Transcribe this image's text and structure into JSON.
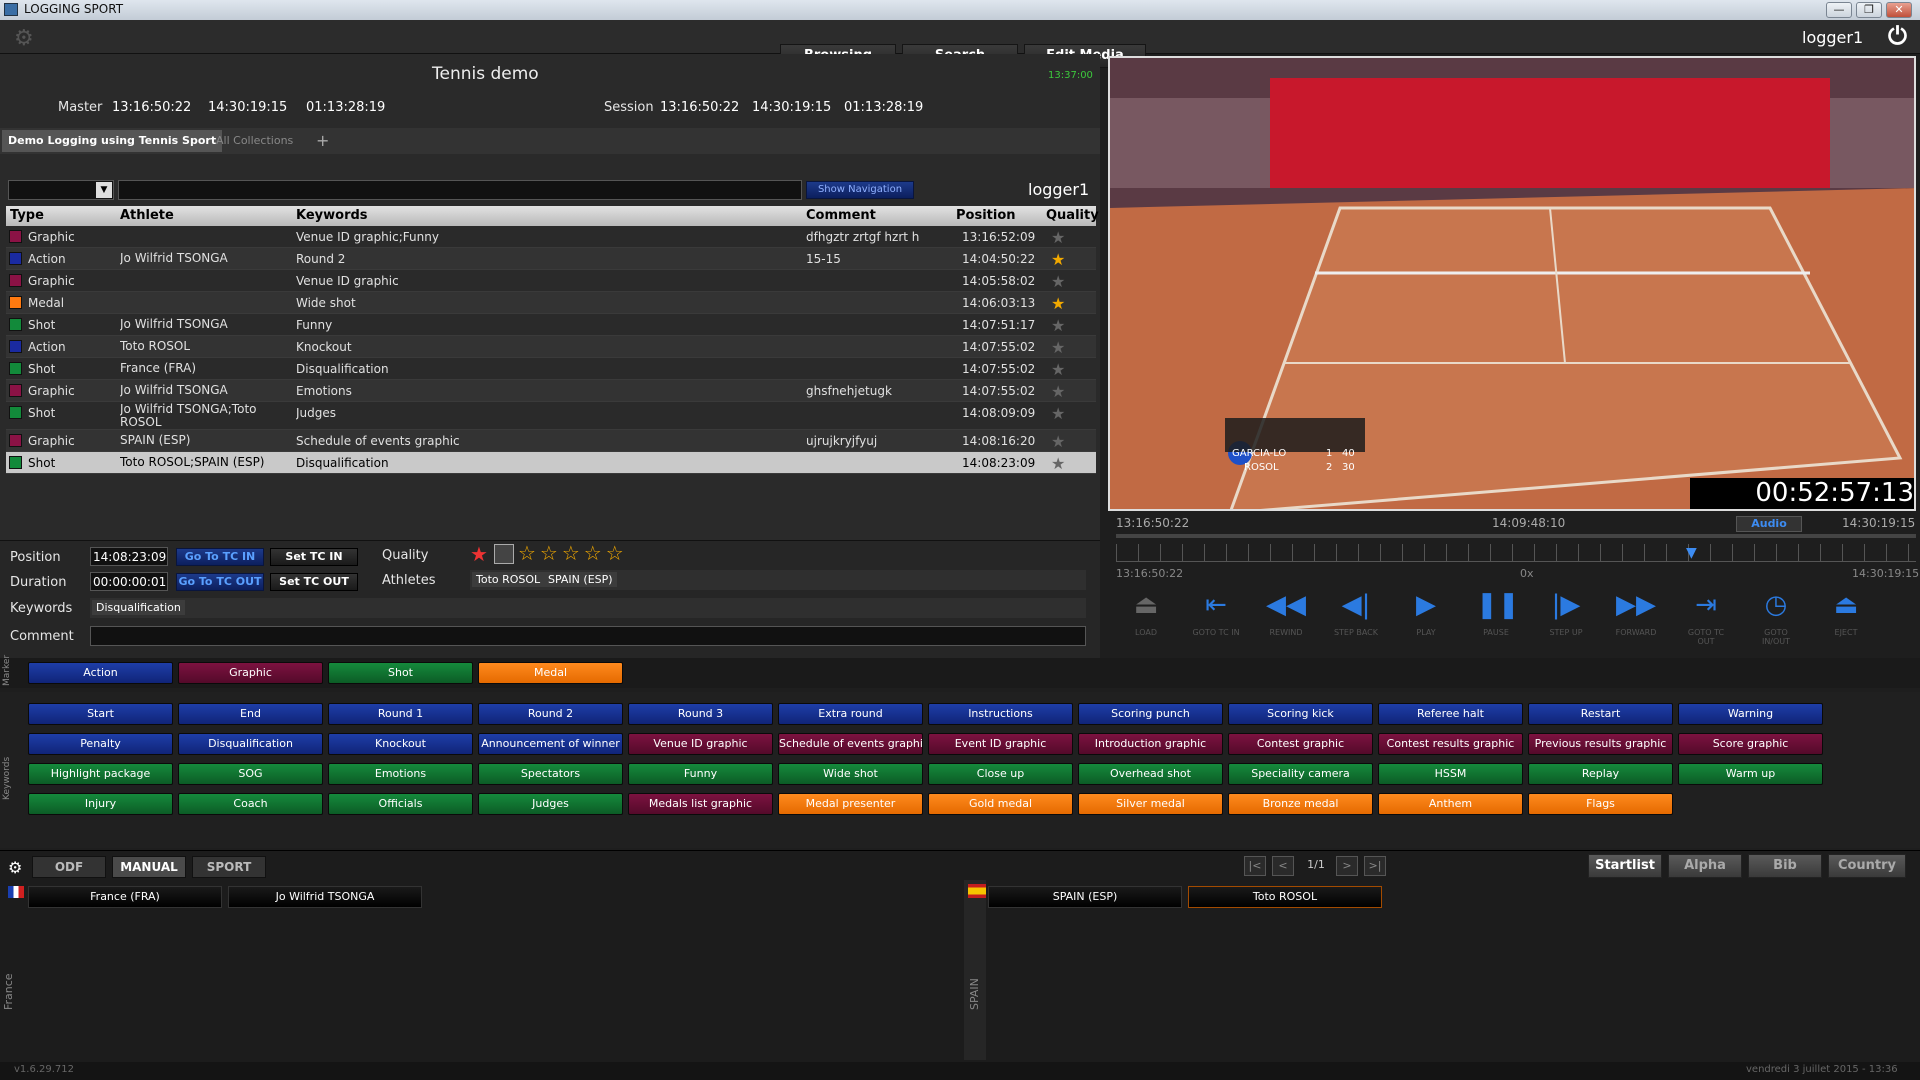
{
  "window": {
    "title": "LOGGING SPORT",
    "min": "—",
    "max": "❐",
    "close": "✕"
  },
  "nav": {
    "browsing": "Browsing",
    "search": "Search",
    "edit_media": "Edit Media",
    "user": "logger1"
  },
  "session": {
    "title": "Tennis demo",
    "clock": "13:37:00",
    "master_label": "Master",
    "master_in": "13:16:50:22",
    "master_out": "14:30:19:15",
    "master_dur": "01:13:28:19",
    "session_label": "Session",
    "session_in": "13:16:50:22",
    "session_out": "14:30:19:15",
    "session_dur": "01:13:28:19"
  },
  "tabs": {
    "active": "Demo Logging using Tennis Sport",
    "all": "All Collections",
    "add": "+"
  },
  "filter": {
    "show_nav": "Show Navigation",
    "user": "logger1"
  },
  "columns": {
    "type": "Type",
    "athlete": "Athlete",
    "keywords": "Keywords",
    "comment": "Comment",
    "position": "Position",
    "quality": "Quality"
  },
  "rows": [
    {
      "color": "#8b1245",
      "type": "Graphic",
      "athlete": "",
      "keywords": "Venue ID graphic;Funny",
      "comment": "dfhgztr zrtgf hzrt h",
      "position": "13:16:52:09",
      "starred": false
    },
    {
      "color": "#1a2aa0",
      "type": "Action",
      "athlete": "Jo Wilfrid TSONGA",
      "keywords": "Round 2",
      "comment": "15-15",
      "position": "14:04:50:22",
      "starred": true
    },
    {
      "color": "#8b1245",
      "type": "Graphic",
      "athlete": "",
      "keywords": "Venue ID graphic",
      "comment": "",
      "position": "14:05:58:02",
      "starred": false
    },
    {
      "color": "#ff7a10",
      "type": "Medal",
      "athlete": "",
      "keywords": "Wide shot",
      "comment": "",
      "position": "14:06:03:13",
      "starred": true
    },
    {
      "color": "#128a3a",
      "type": "Shot",
      "athlete": "Jo Wilfrid TSONGA",
      "keywords": "Funny",
      "comment": "",
      "position": "14:07:51:17",
      "starred": false
    },
    {
      "color": "#1a2aa0",
      "type": "Action",
      "athlete": "Toto ROSOL",
      "keywords": "Knockout",
      "comment": "",
      "position": "14:07:55:02",
      "starred": false
    },
    {
      "color": "#128a3a",
      "type": "Shot",
      "athlete": "France (FRA)",
      "keywords": "Disqualification",
      "comment": "",
      "position": "14:07:55:02",
      "starred": false
    },
    {
      "color": "#8b1245",
      "type": "Graphic",
      "athlete": "Jo Wilfrid TSONGA",
      "keywords": "Emotions",
      "comment": "ghsfnehjetugk",
      "position": "14:07:55:02",
      "starred": false
    },
    {
      "color": "#128a3a",
      "type": "Shot",
      "athlete": "Jo Wilfrid TSONGA;Toto ROSOL",
      "keywords": "Judges",
      "comment": "",
      "position": "14:08:09:09",
      "starred": false
    },
    {
      "color": "#8b1245",
      "type": "Graphic",
      "athlete": "SPAIN (ESP)",
      "keywords": "Schedule of events graphic",
      "comment": "ujrujkryjfyuj",
      "position": "14:08:16:20",
      "starred": false
    },
    {
      "color": "#128a3a",
      "type": "Shot",
      "athlete": "Toto ROSOL;SPAIN (ESP)",
      "keywords": "Disqualification",
      "comment": "",
      "position": "14:08:23:09",
      "starred": false
    }
  ],
  "detail": {
    "position_label": "Position",
    "position": "14:08:23:09",
    "duration_label": "Duration",
    "duration": "00:00:00:01",
    "goto_in": "Go To TC IN",
    "set_in": "Set TC IN",
    "goto_out": "Go To TC OUT",
    "set_out": "Set TC OUT",
    "quality_label": "Quality",
    "athletes_label": "Athletes",
    "athlete1": "Toto ROSOL",
    "athlete2": "SPAIN (ESP)",
    "keywords_label": "Keywords",
    "keyword": "Disqualification",
    "comment_label": "Comment"
  },
  "video": {
    "timecode": "00:52:57:13",
    "tc_start": "13:16:50:22",
    "tc_mid": "14:09:48:10",
    "audio": "Audio",
    "tc_end": "14:30:19:15",
    "tl_start": "13:16:50:22",
    "speed": "0x",
    "tl_end": "14:30:19:15",
    "score_p1": "GARCIA-LO",
    "score_p1_pts": "40",
    "score_p1_set": "1",
    "score_p2": "ROSOL",
    "score_p2_pts": "30",
    "score_p2_set": "2"
  },
  "controls": [
    {
      "icon": "eject-icon",
      "label": "LOAD",
      "glyph": "⏏"
    },
    {
      "icon": "goto-in-icon",
      "label": "GOTO TC IN",
      "glyph": "⇤"
    },
    {
      "icon": "rewind-icon",
      "label": "REWIND",
      "glyph": "◀◀"
    },
    {
      "icon": "step-back-icon",
      "label": "STEP BACK",
      "glyph": "◀|"
    },
    {
      "icon": "play-icon",
      "label": "PLAY",
      "glyph": "▶"
    },
    {
      "icon": "pause-icon",
      "label": "PAUSE",
      "glyph": "❚❚"
    },
    {
      "icon": "step-up-icon",
      "label": "STEP UP",
      "glyph": "|▶"
    },
    {
      "icon": "forward-icon",
      "label": "FORWARD",
      "glyph": "▶▶"
    },
    {
      "icon": "goto-out-icon",
      "label": "GOTO TC OUT",
      "glyph": "⇥"
    },
    {
      "icon": "clock-icon",
      "label": "GOTO IN/OUT",
      "glyph": "◷"
    },
    {
      "icon": "eject-icon",
      "label": "EJECT",
      "glyph": "⏏"
    }
  ],
  "markers": {
    "side": "Marker",
    "action": "Action",
    "graphic": "Graphic",
    "shot": "Shot",
    "medal": "Medal"
  },
  "keywords_side": "Keywords",
  "keywords": [
    [
      "Start",
      "End",
      "Round 1",
      "Round 2",
      "Round 3",
      "Extra round",
      "Instructions",
      "Scoring punch",
      "Scoring kick",
      "Referee halt",
      "Restart",
      "Warning"
    ],
    [
      "Penalty",
      "Disqualification",
      "Knockout",
      "Announcement of winner",
      "Venue ID graphic",
      "Schedule of events graphic",
      "Event ID graphic",
      "Introduction graphic",
      "Contest graphic",
      "Contest results graphic",
      "Previous results graphic",
      "Score graphic"
    ],
    [
      "Highlight package",
      "SOG",
      "Emotions",
      "Spectators",
      "Funny",
      "Wide shot",
      "Close up",
      "Overhead shot",
      "Speciality camera",
      "HSSM",
      "Replay",
      "Warm up"
    ],
    [
      "Injury",
      "Coach",
      "Officials",
      "Judges",
      "Medals list graphic",
      "Medal presenter",
      "Gold medal",
      "Silver medal",
      "Bronze medal",
      "Anthem",
      "Flags"
    ]
  ],
  "keyword_colors": [
    [
      "blue",
      "blue",
      "blue",
      "blue",
      "blue",
      "blue",
      "blue",
      "blue",
      "blue",
      "blue",
      "blue",
      "blue"
    ],
    [
      "blue",
      "blue",
      "blue",
      "blue",
      "maroon",
      "maroon",
      "maroon",
      "maroon",
      "maroon",
      "maroon",
      "maroon",
      "maroon"
    ],
    [
      "green",
      "green",
      "green",
      "green",
      "green",
      "green",
      "green",
      "green",
      "green",
      "green",
      "green",
      "green"
    ],
    [
      "green",
      "green",
      "green",
      "green",
      "maroon",
      "orange",
      "orange",
      "orange",
      "orange",
      "orange",
      "orange"
    ]
  ],
  "bottom": {
    "odf": "ODF",
    "manual": "MANUAL",
    "sport": "SPORT",
    "page": "1/1",
    "first": "|<",
    "prev": "<",
    "next": ">",
    "last": ">|",
    "startlist": "Startlist",
    "alpha": "Alpha",
    "bib": "Bib",
    "country": "Country",
    "france_team": "France (FRA)",
    "france_player": "Jo Wilfrid TSONGA",
    "spain_team": "SPAIN (ESP)",
    "spain_player": "Toto ROSOL",
    "france_side": "France",
    "spain_side": "SPAIN"
  },
  "status": {
    "version": "v1.6.29.712",
    "date": "vendredi 3 juillet 2015 - 13:36"
  }
}
